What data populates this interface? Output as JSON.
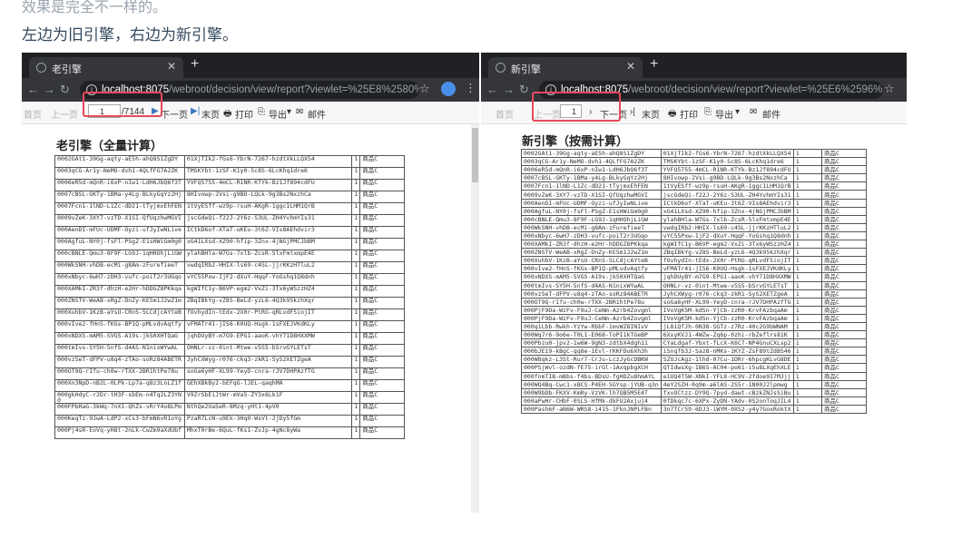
{
  "top_caption": "效果是完全不一样的。",
  "caption": "左边为旧引擎，右边为新引擎。",
  "left": {
    "tab_title": "老引擎",
    "url_host": "localhost:8075",
    "url_path": "/webroot/decision/view/report?viewlet=%25E8%2580%2581%2...",
    "toolbar": {
      "first": "首页",
      "prev": "上一页",
      "page_value": "1",
      "page_total": "/7144",
      "next": "下一页",
      "last": "末页",
      "print": "打印",
      "export": "导出",
      "mail": "邮件"
    },
    "report_title": "老引擎（全量计算）",
    "rows": [
      [
        "0002GAt1-39Gg-aqty-aE5h-ahQ8S1ZgDY",
        "01XjTIk2-fGs6-YbrN-7267-hzdtXkLLQX54",
        "1",
        "商品C"
      ],
      [
        "0003qCG-Ar1y-NeMO-dvh1-4QLfFG7A2ZK",
        "TMSKYbt-1zSF-K1y0-Sc8S-6LcKhq1dre6",
        "1",
        "商品C"
      ],
      [
        "0006eR5d-mQnR-i6xP-nIw1-LdH6JbQ6f3T",
        "YVFQ5755-4mCL-R1NR-KTYk-Bz1Jf894cdFU",
        "1",
        "商品C"
      ],
      [
        "0007cBSL-GKTy-1BMa-y4Lg-BLkyGqYz2Hj",
        "8HIvowp-2Vsi-g9BD-LQLk-9g3Bs2NxzhCa",
        "1",
        "商品C"
      ],
      [
        "0007Fcn1-1lND-L1Zc-dD21-tTyjmxEhFEN",
        "1tVyESff-wz9p-rsuH-AKgR-1ggc1LHM1QrB",
        "1",
        "商品C"
      ],
      [
        "0009vZeK-3XY7-vzTD-X1SI-QfUqzhwMGVI",
        "jscGdeQi-f22J-2Y6z-S3UL-ZH4YvhmYIs31",
        "1",
        "商品C"
      ],
      [
        "000AenDI-mFUc-UDMF-Oyzi-ufJyIwNLive",
        "ICtkD6of-XTaT-uKEu-3t6Z-VIs8AEhdvir3",
        "1",
        "商品C"
      ],
      [
        "000AgfuL-NY0j-fsFl-PSgZ-E1sHWiGm0g0",
        "xG41LXsd-XZ90-hfip-3Znx-4jNGjPMCJbBM",
        "1",
        "商品C"
      ],
      [
        "000cBNLE-Qmu3-8F9F-LG9J-1qHHOhjLiGW",
        "ylahBHla-W7Gs-7xlb-ZcsR-5lxFmtxmpE4E",
        "1",
        "商品C"
      ],
      [
        "000WkSNH-vhDB-ecMi-g8Am-zFurefieeT",
        "vwdqIRb2-HHIX-ls69-c4SL-jjrKKzHTluL2",
        "1",
        "商品C"
      ],
      [
        "000xNbyc-6wH7-zDH3-vufc-poiT2r3UGqo",
        "vYC55Pxw-IjF2-dXuY-HqqF-YoGshq1Q8dnh",
        "1",
        "商品C"
      ],
      [
        "000XAMkI-ZR3f-dhzH-e2Hr-hDDGZ8PKkqa",
        "kgWIfC1y-B6VP-egm2-VxZi-3Tx6yWSzzHZ4",
        "1",
        "商品C"
      ],
      [
        "000ZNSTV-WeAB-xRgZ-DnZy-KE5m1J2wZ1m",
        "ZBqIBkYg-vZ8S-BeLd-yzL6-4Q3k95kzhXqr",
        "1",
        "商品C"
      ],
      [
        "000XuhbV-1KzB-aYsU-CRnS-5LCdjcAYteB",
        "fOvhydIn-tEdx-2X0r-PtRG-qRLvdF5iojIT",
        "1",
        "商品C"
      ],
      [
        "000vIve2-fHnS-fKGs-BP1Q-pMLvdvAqtfy",
        "vFMATr41-jIS6-K0UQ-Hsgk-1sFXEJVKdKLy",
        "1",
        "商品C"
      ],
      [
        "000xNDXS-mAM5-SVGS-A19s-jkS0XHTQaG",
        "jqhDUyBY-m7G9-EPG1-aaoK-vhY71D8HXXMW",
        "1",
        "商品C"
      ],
      [
        "000tmIvs-SY5H-5nfS-d4AS-N1nixWYwAL",
        "OHNLr-vz-0int-Mtwe-v5S5-bSrvGYLETsT",
        "1",
        "商品C"
      ],
      [
        "000vzSeT-dFPV-u8q4-zTAo-soRz84ABETR",
        "JyhCXWyg-r076-ckq3-zkR1-SyS2XETZgeA",
        "1",
        "商品C"
      ],
      [
        "000OT9Q-rIfu-ch0w-rTXX-2BR1htPe78u",
        "soGa6yHF-XL99-YeyD-cnra-rJV7DHPAzfTG",
        "1",
        "商品C"
      ],
      [
        "000Xn3NpD-nB2L-0LPk-Lp7a-q8z3LnLZ1f",
        "GEhXBkBy2-bEFqG-lJEL-qaqhMA",
        "1",
        "商品C"
      ],
      [
        "000gkHdyC-r2Dr-tH3F-sbEm-n4Tq2LZ3YNd",
        "V9ZrSbEiJtWr-mVa5-ZY3x6Lk1F",
        "1",
        "商品C"
      ],
      [
        "000FPbHaG-3kWq-7nX1-QhZs-vRrY4o8LPm",
        "NthQe2UaSeR-8Mzq-yHt1-4pV0",
        "1",
        "商品C"
      ],
      [
        "000KeqTz-9JwA-LdP2-xCs3-bFmN6vR1oYg",
        "PzaR7LcN-u9Ek-3Hq0-WsVt-2jDy5fGm",
        "1",
        "商品C"
      ],
      [
        "000Pj4sR-EoVq-yH8t-2nLk-CwZm9aXdUbf",
        "MhxT0rBe-6QuL-fKs1-ZvJp-4gNc8yWa",
        "1",
        "商品C"
      ]
    ]
  },
  "right": {
    "tab_title": "新引擎",
    "url_host": "localhost:8075",
    "url_path": "/webroot/decision/view/report?viewlet=%25E6%2596%25B0%2...",
    "toolbar": {
      "first": "首页",
      "prev": "上一页",
      "page_value": "1",
      "next": "下一页",
      "last": "末页",
      "print": "打印",
      "export": "导出",
      "mail": "邮件"
    },
    "report_title": "新引擎（按需计算）",
    "rows": [
      [
        "0002GAt1-39Gg-aqty-aE5h-ahQ8S1ZgDY",
        "01XjTIk2-fGs6-YbrN-7267-hzdtXkLLQX54",
        "1",
        "商品C"
      ],
      [
        "0003qCG-Ar1y-NeMO-dvh1-4QLfFG7A2ZK",
        "TMSKYbt-1zSF-K1y0-Sc8S-6LcKhq1dre6",
        "1",
        "商品C"
      ],
      [
        "0006eR5d-mQnR-i6xP-nIw1-LdH6JbQ6f3T",
        "YVFQ5755-4mCL-R1NR-KTYk-Bz1Jf894cdFU",
        "1",
        "商品C"
      ],
      [
        "0007cBSL-GKTy-1BMa-y4Lg-BLkyGqYz2Hj",
        "8HIvowp-2Vsi-g9BD-LQLk-9g3Bs2NxzhCa",
        "1",
        "商品C"
      ],
      [
        "0007Fcn1-1lND-L1Zc-dD21-tTyjmxEhFEN",
        "1tVyESff-wz9p-rsuH-AKgR-1ggc1LHM1QrB",
        "1",
        "商品C"
      ],
      [
        "0009vZeK-3XY7-vzTD-X1SI-QfUqzhwMGVI",
        "jscGdeQi-f22J-2Y6z-S3UL-ZH4YvhmYIs31",
        "1",
        "商品C"
      ],
      [
        "000AenDI-mFUc-UDMF-Oyzi-ufJyIwNLive",
        "ICtkD6of-XTaT-uKEu-3t6Z-VIs8AEhdvir3",
        "1",
        "商品C"
      ],
      [
        "000AgfuL-NY0j-fsFl-PSgZ-E1sHWiGm0g0",
        "xG41LXsd-XZ90-hfip-3Znx-4jNGjPMCJbBM",
        "1",
        "商品C"
      ],
      [
        "000cBNLE-Qmu3-8F9F-LG9J-1qHHOhjLiGW",
        "ylahBHla-W7Gs-7xlb-ZcsR-5lxFmtxmpE4E",
        "1",
        "商品C"
      ],
      [
        "000WkSNH-vhDB-ecMi-g8Am-zFurefieeT",
        "vwdqIRb2-HHIX-ls69-c4SL-jjrKKzHTluL2",
        "1",
        "商品C"
      ],
      [
        "000xNbyc-6wH7-zDH3-vufc-poiT2r3UGqo",
        "vYC55Pxw-IjF2-dXuY-HqqF-YoGshq1Q8dnh",
        "1",
        "商品C"
      ],
      [
        "000XAMkI-ZR3f-dhzH-e2Hr-hDDGZ8PKkqa",
        "kgWIfC1y-B6VP-egm2-VxZi-3Tx6yWSzzHZ4",
        "1",
        "商品C"
      ],
      [
        "000ZNSTV-WeAB-xRgZ-DnZy-KE5m1J2wZ1m",
        "ZBqIBkYg-vZ8S-BeLd-yzL6-4Q3k95kzhXqr",
        "1",
        "商品C"
      ],
      [
        "000XuhbV-1KzB-aYsU-CRnS-5LCdjcAYteB",
        "fOvhydIn-tEdx-2X0r-PtRG-qRLvdF5iojIT",
        "1",
        "商品C"
      ],
      [
        "000vIve2-fHnS-fKGs-BP1Q-pMLvdvAqtfy",
        "vFMATr41-jIS6-K0UQ-Hsgk-1sFXEJVKdKLy",
        "1",
        "商品C"
      ],
      [
        "000xNDXS-mAM5-SVGS-A19s-jkS0XHTQaG",
        "jqhDUyBY-m7G9-EPG1-aaoK-vhY71D8HXXMW",
        "1",
        "商品C"
      ],
      [
        "000tmIvs-SY5H-5nfS-d4AS-N1nixWYwAL",
        "OHNLr-vz-0int-Mtwe-v5S5-bSrvGYLETsT",
        "1",
        "商品C"
      ],
      [
        "000vzSeT-dFPV-u8q4-zTAo-soRz84ABETR",
        "JyhCXWyg-r076-ckq3-zkR1-SyS2XETZgeA",
        "1",
        "商品C"
      ],
      [
        "000OT9Q-rIfu-ch0w-rTXX-2BR1htPe78u",
        "soGa6yHF-XL99-YeyD-cnra-rJV7DHPAzfTG",
        "1",
        "商品C"
      ],
      [
        "000PjF9Da-WzFv-F9uJ-CeNm-Azrb4Zovgml",
        "IVoVgK5M-kdSn-YjCb-zzR0-KrvFAzbqaAm",
        "1",
        "商品C"
      ],
      [
        "000PjF9Da-WzFv-F9uJ-CeNm-Azrb4Zovgml",
        "IVoVgK5M-kdSn-YjCb-zzR0-KrvFAzbqaAm",
        "1",
        "商品C"
      ],
      [
        "000q1Lbb-Rwkh-YzYw-RbbF-1mvWZ8INIvV",
        "jL81QfJh-0N38-SGTz-z7Rz-40c2G9bWNAM",
        "1",
        "商品C"
      ],
      [
        "000Wq7r6-9o6e-T0L1-E068-ToPI1kTGeBP",
        "6XxyKVJ1-4WZw-Zq6p-0zhi-rbZeflrs81K",
        "1",
        "商品C"
      ],
      [
        "000Pbzu0-jpv2-1w6W-9gN3-zdtbX4dgh11",
        "CYaLdgaf-Ybxt-fLcX-K6C7-NP4GnuCXLsp2",
        "1",
        "商品C"
      ],
      [
        "000bJE19-kBgC-qq8e-1Evl-rKKFDu6Xh3h",
        "iSnqfb3J-Saz8-nMKs-1KYZ-ZsF89tZdBS46",
        "1",
        "商品C"
      ],
      [
        "000W8qkz-L3St-Rur7-CrJu-LczJyGcDBKW",
        "SZUJcAgz-1lhd-07Cu-1DRr-6hpcgKLvG8DE",
        "1",
        "商品C"
      ],
      [
        "000PSjWvl-ozdN-fE75-irGl-1AxqpbgXCH",
        "QTIdwsXg-IB6S-AC04-po61-i5u8LXqEhXLE",
        "1",
        "商品C"
      ],
      [
        "000fnmTIB-mBbs-f4bs-BDsU-fgHDZu8hmAYL",
        "e1UQ4T5W-XNkI-YFL8-HC9V-2fdoe9I7MJjj",
        "1",
        "商品C"
      ],
      [
        "000WQ4Bq-Cwc1-xBCS-P4EH-SGYsp-jYUB-q3n",
        "4eY2SZH-0q9m-a6lAS-2S5r-1N00J2lpmwg",
        "1",
        "商品C"
      ],
      [
        "000W9bDb-FKXV-KmRy-VzVK-lh7QB5M5E4T",
        "fxvOCtzz-DY9Q-7pyd-dawt-cBzkZNJsSiBu",
        "1",
        "商品C"
      ],
      [
        "000aPwHr-CHbF-0SLS-HfMk-dkFU2Axjuj4",
        "0fDkqc7c-6XPx-ZyDN-YAdv-0S2onToqJIL4",
        "1",
        "商品C"
      ],
      [
        "000Pash6F-aN6W-WRS8-i415-1FknJNPLFBn",
        "3n7TCr59-6DJ3-iWYM-0XS2-y4y7GoxRoktX",
        "1",
        "商品C"
      ]
    ]
  }
}
